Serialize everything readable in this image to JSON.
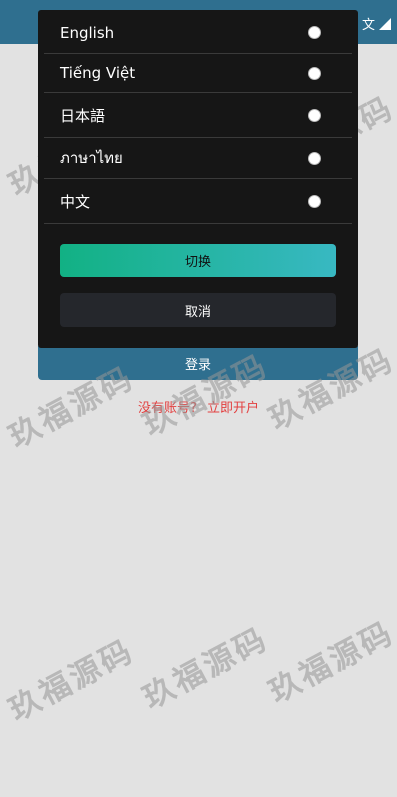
{
  "header": {
    "current_language_label": "文"
  },
  "dialog": {
    "languages": [
      {
        "label": "English",
        "selected": false
      },
      {
        "label": "Tiếng Việt",
        "selected": false
      },
      {
        "label": "日本語",
        "selected": false
      },
      {
        "label": "ภาษาไทย",
        "selected": false
      },
      {
        "label": "中文",
        "selected": false
      }
    ],
    "switch_label": "切换",
    "cancel_label": "取消"
  },
  "login": {
    "button_label": "登录",
    "no_account_text": "没有账号?",
    "register_link": "立即开户"
  },
  "watermark": {
    "text": "玖福源码"
  },
  "colors": {
    "header_bg": "#2f6f8f",
    "dialog_bg": "#161616",
    "accent_start": "#12b184",
    "accent_end": "#38b8c2",
    "register_link": "#e34040",
    "page_bg": "#e2e2e2"
  }
}
